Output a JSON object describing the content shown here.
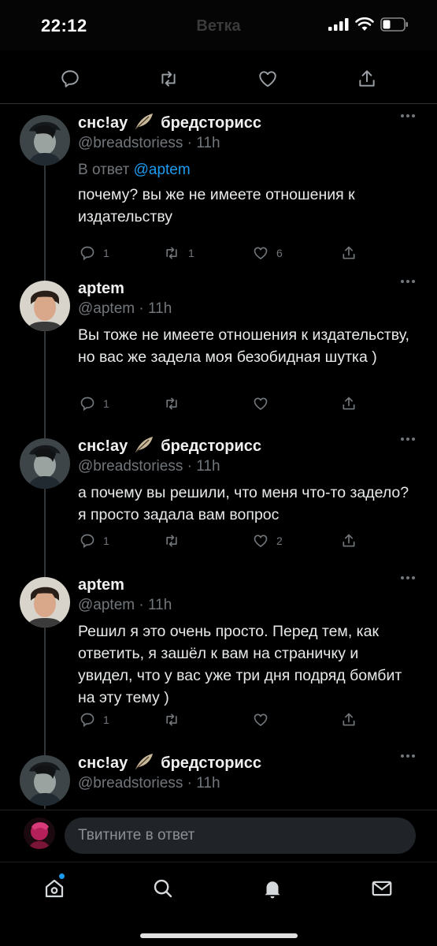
{
  "status_bar": {
    "time": "22:12",
    "title": "Ветка"
  },
  "thread": {
    "tweets": [
      {
        "display_name": "снс!ау",
        "display_name_suffix": "бредсторисс",
        "handle": "@breadstoriess",
        "time": "11h",
        "reply_to_prefix": "В ответ",
        "reply_to_mention": "@aptem",
        "text": "почему? вы же не имеете отношения к издательству",
        "replies": "1",
        "retweets": "1",
        "likes": "6"
      },
      {
        "display_name": "aptem",
        "handle": "@aptem",
        "time": "11h",
        "text": "Вы тоже не имеете отношения к издательству, но вас же задела моя безобидная шутка )",
        "replies": "1",
        "retweets": "",
        "likes": ""
      },
      {
        "display_name": "снс!ау",
        "display_name_suffix": "бредсторисс",
        "handle": "@breadstoriess",
        "time": "11h",
        "text": "а почему вы решили, что меня что-то задело? я просто задала вам вопрос",
        "replies": "1",
        "retweets": "",
        "likes": "2"
      },
      {
        "display_name": "aptem",
        "handle": "@aptem",
        "time": "11h",
        "text": "Решил я это очень просто. Перед тем, как ответить, я зашёл к вам на страничку и увидел, что у вас уже три дня подряд бомбит на эту тему )",
        "replies": "1",
        "retweets": "",
        "likes": ""
      },
      {
        "display_name": "снс!ау",
        "display_name_suffix": "бредсторисс",
        "handle": "@breadstoriess",
        "time": "11h",
        "text": ""
      }
    ]
  },
  "reply_box": {
    "placeholder": "Твитните в ответ"
  },
  "icons": {
    "reply": "reply-icon",
    "retweet": "retweet-icon",
    "like": "heart-icon",
    "share": "share-icon",
    "home": "home-icon",
    "search": "search-icon",
    "notifications": "bell-icon",
    "messages": "mail-icon"
  },
  "colors": {
    "accent": "#1d9bf0",
    "muted": "#71767b",
    "background": "#000000"
  }
}
